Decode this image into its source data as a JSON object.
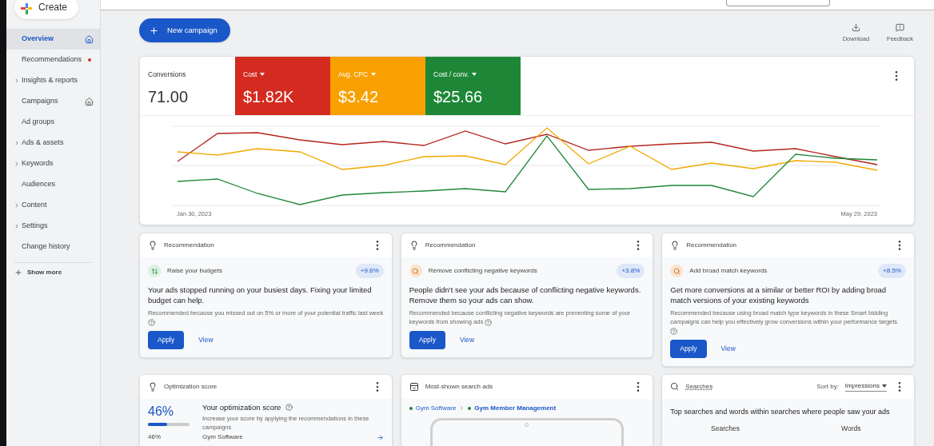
{
  "create_button": {
    "label": "Create"
  },
  "sidebar": {
    "items": [
      {
        "label": "Overview",
        "selected": true,
        "expandable": false,
        "pinned": true,
        "alert": false
      },
      {
        "label": "Recommendations",
        "selected": false,
        "expandable": false,
        "pinned": false,
        "alert": true
      },
      {
        "label": "Insights & reports",
        "selected": false,
        "expandable": true,
        "pinned": false,
        "alert": false
      },
      {
        "label": "Campaigns",
        "selected": false,
        "expandable": false,
        "pinned": true,
        "alert": false
      },
      {
        "label": "Ad groups",
        "selected": false,
        "expandable": false,
        "pinned": false,
        "alert": false
      },
      {
        "label": "Ads & assets",
        "selected": false,
        "expandable": true,
        "pinned": false,
        "alert": false
      },
      {
        "label": "Keywords",
        "selected": false,
        "expandable": true,
        "pinned": false,
        "alert": false
      },
      {
        "label": "Audiences",
        "selected": false,
        "expandable": false,
        "pinned": false,
        "alert": false
      },
      {
        "label": "Content",
        "selected": false,
        "expandable": true,
        "pinned": false,
        "alert": false
      },
      {
        "label": "Settings",
        "selected": false,
        "expandable": true,
        "pinned": false,
        "alert": false
      },
      {
        "label": "Change history",
        "selected": false,
        "expandable": false,
        "pinned": false,
        "alert": false
      }
    ],
    "show_more": "Show more"
  },
  "toolbar": {
    "new_campaign": "New campaign",
    "actions": [
      {
        "kind": "download",
        "label": "Download"
      },
      {
        "kind": "feedback",
        "label": "Feedback"
      }
    ]
  },
  "metrics": [
    {
      "label": "Conversions",
      "value": "71.00",
      "dropdown": false
    },
    {
      "label": "Cost",
      "value": "$1.82K",
      "dropdown": true,
      "color": "#d32b20"
    },
    {
      "label": "Avg. CPC",
      "value": "$3.42",
      "dropdown": true,
      "color": "#f8a000"
    },
    {
      "label": "Cost / conv.",
      "value": "$25.66",
      "dropdown": true,
      "color": "#1e8737"
    }
  ],
  "chart": {
    "start_label": "Jan 30, 2023",
    "end_label": "May 29, 2023"
  },
  "recommendations": [
    {
      "title": "Recommendation",
      "kind": "budget",
      "name": "Raise your budgets",
      "uplift": "+9.6%",
      "headline": "Your ads stopped running on your busiest days. Fixing your limited budget can help.",
      "reason": "Recommended because you missed out on 5% or more of your potential traffic last week",
      "apply": "Apply",
      "view": "View"
    },
    {
      "title": "Recommendation",
      "kind": "search",
      "name": "Remove conflicting negative keywords",
      "uplift": "+3.8%",
      "headline": "People didn't see your ads because of conflicting negative keywords. Remove them so your ads can show.",
      "reason": "Recommended because conflicting negative keywords are preventing some of your keywords from showing ads",
      "apply": "Apply",
      "view": "View"
    },
    {
      "title": "Recommendation",
      "kind": "search",
      "name": "Add broad match keywords",
      "uplift": "+8.5%",
      "headline": "Get more conversions at a similar or better ROI by adding broad match versions of your existing keywords",
      "reason": "Recommended because using broad match type keywords in these Smart bidding campaigns can help you effectively grow conversions within your performance targets",
      "apply": "Apply",
      "view": "View"
    }
  ],
  "optimization": {
    "title": "Optimization score",
    "score": "46%",
    "level": 0.46,
    "heading": "Your optimization score",
    "description": "Increase your score by applying the recommendations in these campaigns",
    "row": {
      "score": "46%",
      "campaign": "Gym Software"
    }
  },
  "search_ads": {
    "title": "Most-shown search ads",
    "path": [
      "Gym Software",
      "Gym Member Management"
    ]
  },
  "searches": {
    "title": "Searches",
    "sort_label": "Sort by:",
    "sort_value": "Impressions",
    "description": "Top searches and words within searches where people saw your ads",
    "columns": [
      "Searches",
      "Words"
    ]
  }
}
